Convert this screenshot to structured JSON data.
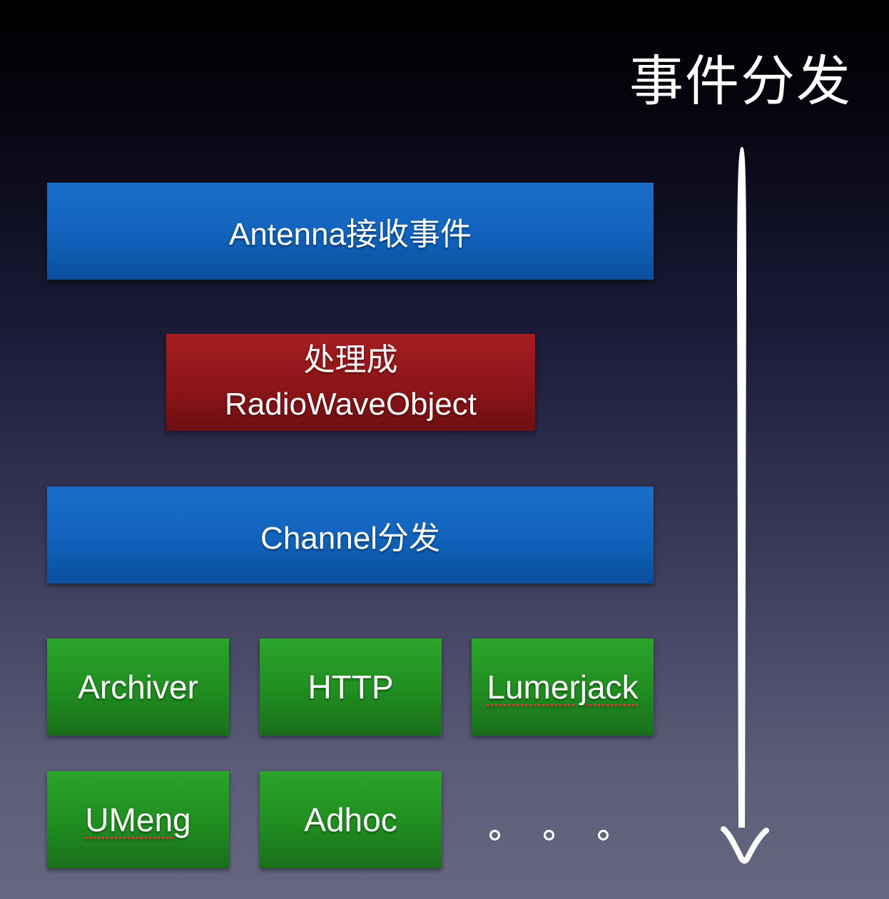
{
  "title": "事件分发",
  "steps": {
    "receive": "Antenna接收事件",
    "process_line1": "处理成",
    "process_line2": "RadioWaveObject",
    "dispatch": "Channel分发"
  },
  "channels": [
    "Archiver",
    "HTTP",
    "Lumerjack",
    "UMeng",
    "Adhoc"
  ],
  "colors": {
    "step_box": "#1264be",
    "process_box": "#8d1519",
    "channel_box": "#208d20",
    "background_top": "#000000",
    "background_bottom": "#666780"
  },
  "icons": {
    "ellipsis": "more-icon",
    "flow_arrow": "arrow-down-icon"
  }
}
